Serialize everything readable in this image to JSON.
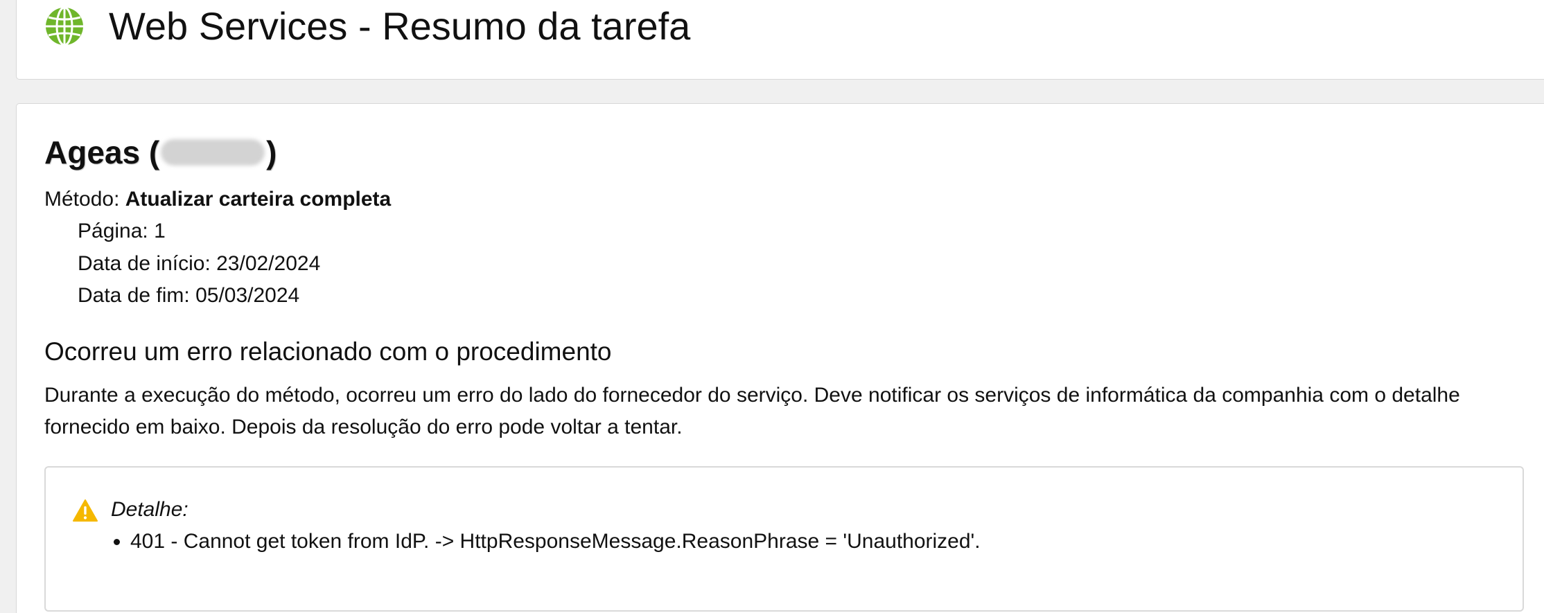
{
  "header": {
    "title": "Web Services - Resumo da tarefa",
    "icon": "globe-icon",
    "icon_color": "#6fb62b"
  },
  "summary": {
    "provider_name": "Ageas (",
    "provider_suffix": ")",
    "method_label": "Método:",
    "method_value": "Atualizar carteira completa",
    "page_text": "Página: 1",
    "start_date_text": "Data de início: 23/02/2024",
    "end_date_text": "Data de fim: 05/03/2024"
  },
  "error": {
    "heading": "Ocorreu um erro relacionado com o procedimento",
    "description": "Durante a execução do método, ocorreu um erro do lado do fornecedor do serviço. Deve notificar os serviços de informática da companhia com o detalhe fornecido em baixo. Depois da resolução do erro pode voltar a tentar.",
    "detail_label": "Detalhe:",
    "detail_items": [
      "401 - Cannot get token from IdP. -> HttpResponseMessage.ReasonPhrase = 'Unauthorized'."
    ],
    "warning_icon": "warning-icon",
    "warning_color": "#f5b800"
  }
}
